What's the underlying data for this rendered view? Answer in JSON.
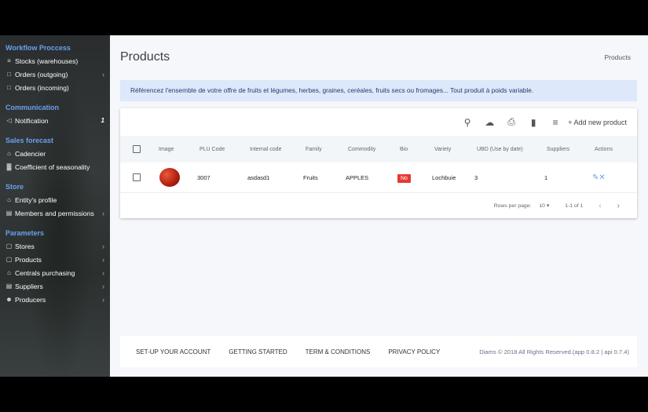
{
  "sidebar": {
    "sections": [
      {
        "title": "Workflow Proccess",
        "items": [
          {
            "icon": "warehouse-icon",
            "label": "Stocks (warehouses)",
            "chev": false
          },
          {
            "icon": "calendar-icon",
            "label": "Orders (outgoing)",
            "chev": true
          },
          {
            "icon": "calendar-icon",
            "label": "Orders (incoming)",
            "chev": false
          }
        ]
      },
      {
        "title": "Communication",
        "items": [
          {
            "icon": "megaphone-icon",
            "label": "Notification",
            "count": "1"
          }
        ]
      },
      {
        "title": "Sales forecast",
        "items": [
          {
            "icon": "cart-icon",
            "label": "Cadencier"
          },
          {
            "icon": "bar-chart-icon",
            "label": "Coefficient of seasonality"
          }
        ]
      },
      {
        "title": "Store",
        "items": [
          {
            "icon": "cart-icon",
            "label": "Entity's profile"
          },
          {
            "icon": "id-card-icon",
            "label": "Members and permissions",
            "chev": true
          }
        ]
      },
      {
        "title": "Parameters",
        "items": [
          {
            "icon": "box-icon",
            "label": "Stores",
            "chev": true
          },
          {
            "icon": "box-icon",
            "label": "Products",
            "chev": true
          },
          {
            "icon": "building-icon",
            "label": "Centrals purchasing",
            "chev": true
          },
          {
            "icon": "id-card-icon",
            "label": "Suppliers",
            "chev": true
          },
          {
            "icon": "person-icon",
            "label": "Producers",
            "chev": true
          }
        ]
      }
    ]
  },
  "page": {
    "title": "Products",
    "breadcrumb": "Products",
    "banner": "Référencez l'ensemble de votre offre de fruits et légumes, herbes, graines, ceréales, fruits secs ou fromages... Tout produit à poids variable."
  },
  "toolbar": {
    "add_label": "+ Add new product"
  },
  "table": {
    "columns": [
      "Image",
      "PLU Code",
      "Internal code",
      "Family",
      "Commodity",
      "Bio",
      "Variety",
      "UBD (Use by date)",
      "Suppliers",
      "Actions"
    ],
    "rows": [
      {
        "plu": "3007",
        "internal": "asdasd1",
        "family": "Fruits",
        "commodity": "APPLES",
        "bio": "No",
        "variety": "Lochbuie",
        "ubd": "3",
        "suppliers": "1"
      }
    ]
  },
  "pagination": {
    "rows_label": "Rows per page:",
    "rows_value": "10",
    "range": "1-1 of 1"
  },
  "footer": {
    "links": [
      "SET-UP YOUR ACCOUNT",
      "GETTING STARTED",
      "TERM & CONDITIONS",
      "PRIVACY POLICY"
    ],
    "copyright": "Diams © 2018 All Rights Reserved.(app 0.8.2 | api 0.7.4)"
  },
  "colors": {
    "accent": "#6aa0ef",
    "badge": "#e53935",
    "banner": "#dde8fb"
  }
}
